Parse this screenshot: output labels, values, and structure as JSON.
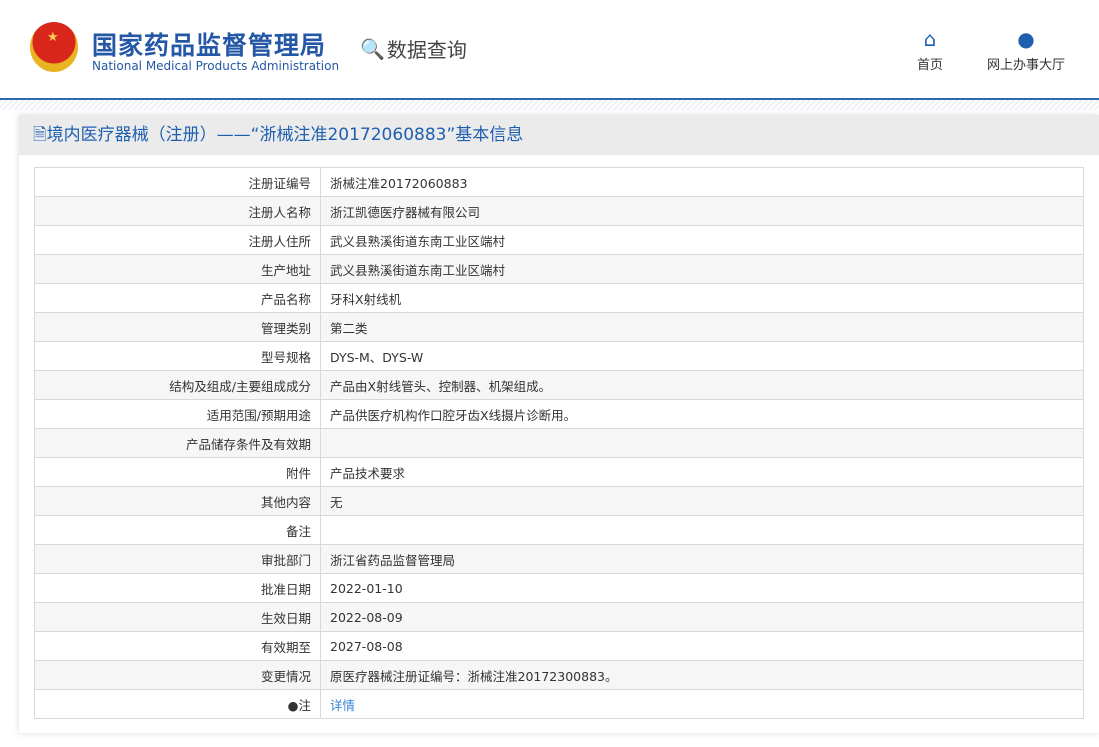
{
  "header": {
    "logo_cn": "国家药品监督管理局",
    "logo_en": "National Medical Products Administration",
    "data_query": "数据查询",
    "nav": [
      {
        "label": "首页",
        "icon": "home-icon"
      },
      {
        "label": "网上办事大厅",
        "icon": "user-icon"
      }
    ]
  },
  "title": "境内医疗器械（注册）——“浙械注准20172060883”基本信息",
  "rows": [
    {
      "label": "注册证编号",
      "value": "浙械注准20172060883"
    },
    {
      "label": "注册人名称",
      "value": "浙江凯德医疗器械有限公司"
    },
    {
      "label": "注册人住所",
      "value": "武义县熟溪街道东南工业区端村"
    },
    {
      "label": "生产地址",
      "value": "武义县熟溪街道东南工业区端村"
    },
    {
      "label": "产品名称",
      "value": "牙科X射线机"
    },
    {
      "label": "管理类别",
      "value": "第二类"
    },
    {
      "label": "型号规格",
      "value": "DYS-M、DYS-W"
    },
    {
      "label": "结构及组成/主要组成成分",
      "value": "产品由X射线管头、控制器、机架组成。"
    },
    {
      "label": "适用范围/预期用途",
      "value": "产品供医疗机构作口腔牙齿X线摄片诊断用。"
    },
    {
      "label": "产品储存条件及有效期",
      "value": ""
    },
    {
      "label": "附件",
      "value": "产品技术要求"
    },
    {
      "label": "其他内容",
      "value": "无"
    },
    {
      "label": "备注",
      "value": ""
    },
    {
      "label": "审批部门",
      "value": "浙江省药品监督管理局"
    },
    {
      "label": "批准日期",
      "value": "2022-01-10"
    },
    {
      "label": "生效日期",
      "value": "2022-08-09"
    },
    {
      "label": "有效期至",
      "value": "2027-08-08"
    },
    {
      "label": "变更情况",
      "value": "原医疗器械注册证编号：浙械注准20172300883。"
    }
  ],
  "note": {
    "label": "注",
    "link": "详情"
  }
}
